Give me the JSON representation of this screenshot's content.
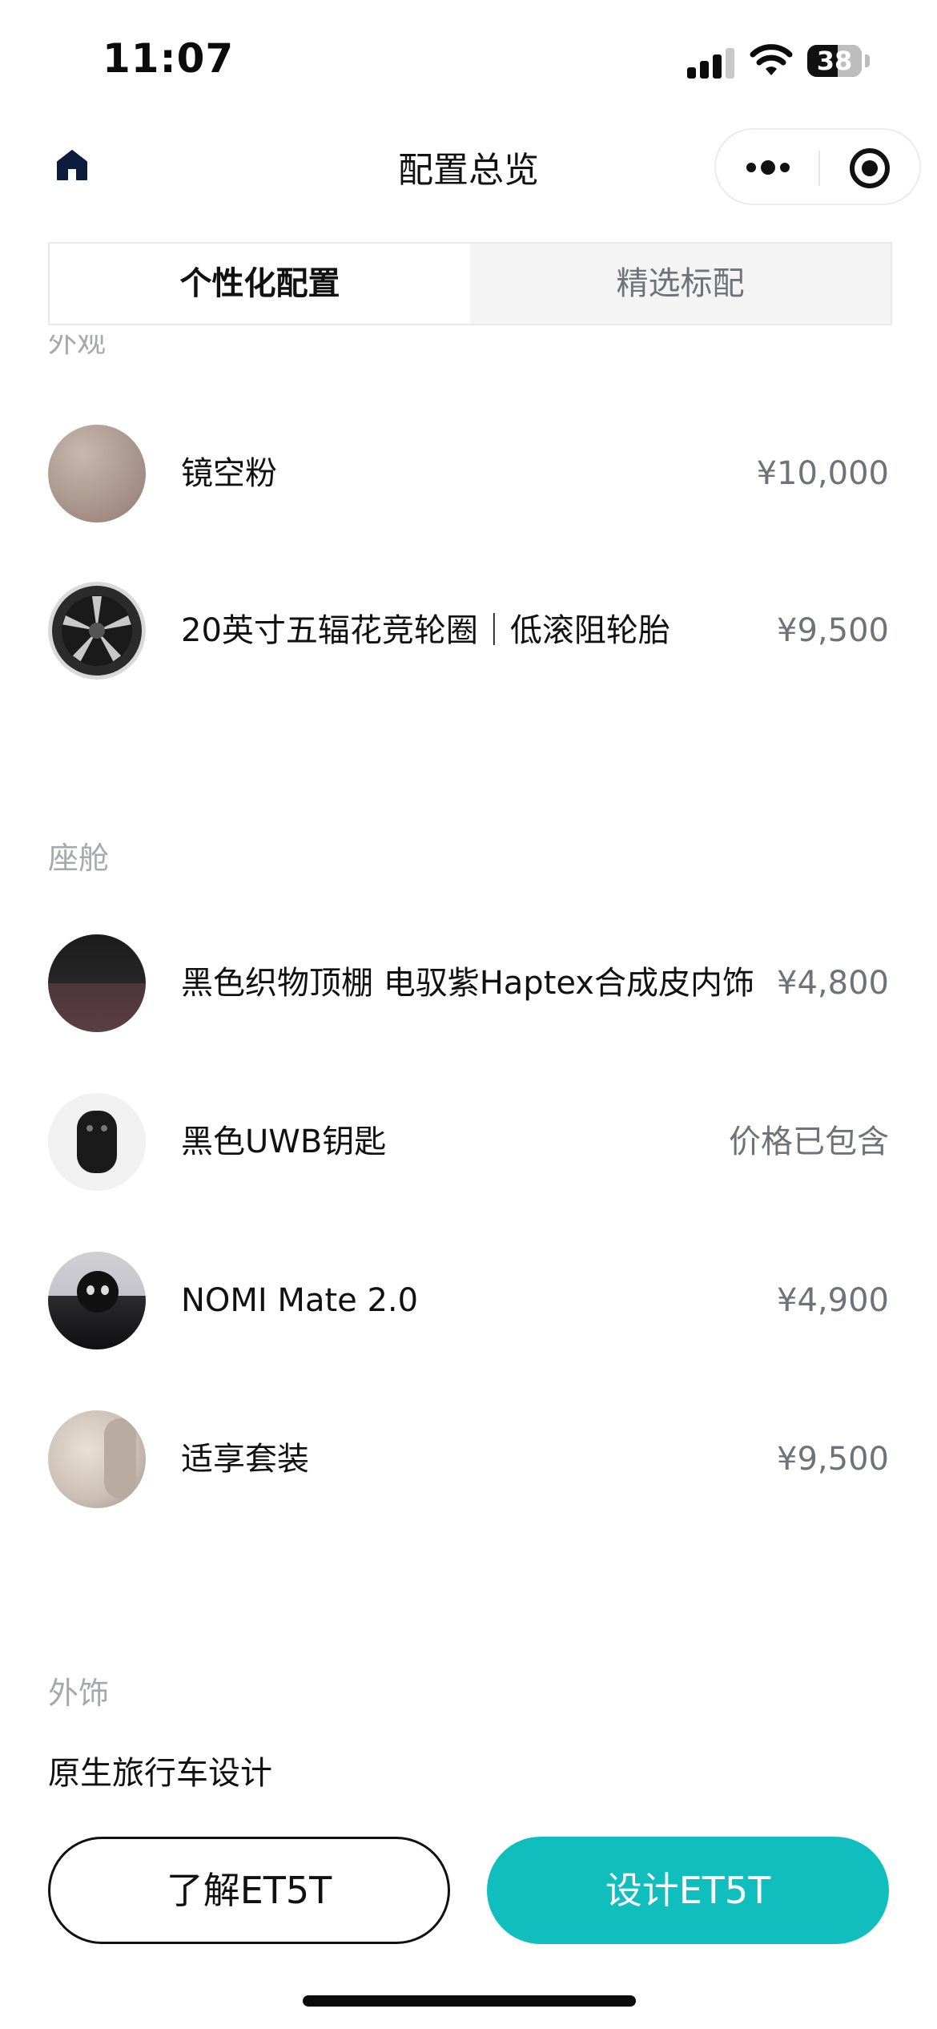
{
  "status_bar": {
    "time": "11:07",
    "battery": "38"
  },
  "nav": {
    "title": "配置总览"
  },
  "tabs": [
    {
      "label": "个性化配置",
      "active": true
    },
    {
      "label": "精选标配",
      "active": false
    }
  ],
  "sections": {
    "exterior": {
      "title": "外观",
      "items": [
        {
          "name": "镜空粉",
          "price": "¥10,000"
        },
        {
          "name": "20英寸五辐花竞轮圈｜低滚阻轮胎",
          "price": "¥9,500"
        }
      ]
    },
    "cabin": {
      "title": "座舱",
      "items": [
        {
          "name": "黑色织物顶棚 电驭紫Haptex合成皮内饰",
          "price": "¥4,800"
        },
        {
          "name": "黑色UWB钥匙",
          "price": "价格已包含"
        },
        {
          "name": "NOMI Mate 2.0",
          "price": "¥4,900"
        },
        {
          "name": "适享套装",
          "price": "¥9,500"
        }
      ]
    },
    "exterior_trim": {
      "title": "外饰",
      "items": [
        "原生旅行车设计"
      ]
    }
  },
  "buttons": {
    "learn": "了解ET5T",
    "design": "设计ET5T"
  },
  "colors": {
    "accent": "#10bfbd",
    "muted_text": "#a6a8ad",
    "price_text": "#6f7278"
  }
}
